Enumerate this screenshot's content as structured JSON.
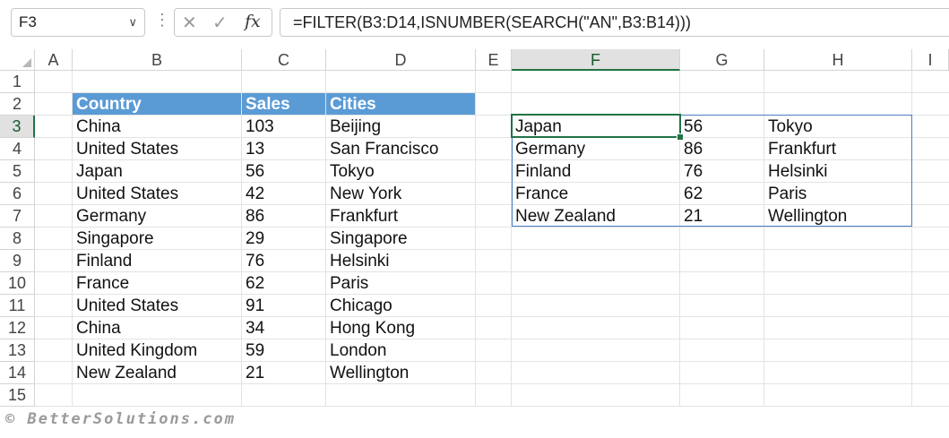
{
  "name_box": {
    "value": "F3",
    "chevron": "chevron-down-icon"
  },
  "formula_bar": {
    "more_icon": "⋮",
    "cancel_icon": "✕",
    "enter_icon": "✓",
    "fx_label": "fx",
    "formula": "=FILTER(B3:D14,ISNUMBER(SEARCH(\"AN\",B3:B14)))"
  },
  "columns": [
    "A",
    "B",
    "C",
    "D",
    "E",
    "F",
    "G",
    "H",
    "I"
  ],
  "selected_column": "F",
  "rows": [
    "1",
    "2",
    "3",
    "4",
    "5",
    "6",
    "7",
    "8",
    "9",
    "10",
    "11",
    "12",
    "13",
    "14",
    "15"
  ],
  "selected_row": "3",
  "source_table": {
    "headers": [
      "Country",
      "Sales",
      "Cities"
    ],
    "rows": [
      [
        "China",
        "103",
        "Beijing"
      ],
      [
        "United States",
        "13",
        "San Francisco"
      ],
      [
        "Japan",
        "56",
        "Tokyo"
      ],
      [
        "United States",
        "42",
        "New York"
      ],
      [
        "Germany",
        "86",
        "Frankfurt"
      ],
      [
        "Singapore",
        "29",
        "Singapore"
      ],
      [
        "Finland",
        "76",
        "Helsinki"
      ],
      [
        "France",
        "62",
        "Paris"
      ],
      [
        "United States",
        "91",
        "Chicago"
      ],
      [
        "China",
        "34",
        "Hong Kong"
      ],
      [
        "United Kingdom",
        "59",
        "London"
      ],
      [
        "New Zealand",
        "21",
        "Wellington"
      ]
    ]
  },
  "result_table": {
    "rows": [
      [
        "Japan",
        "56",
        "Tokyo"
      ],
      [
        "Germany",
        "86",
        "Frankfurt"
      ],
      [
        "Finland",
        "76",
        "Helsinki"
      ],
      [
        "France",
        "62",
        "Paris"
      ],
      [
        "New Zealand",
        "21",
        "Wellington"
      ]
    ]
  },
  "colors": {
    "header_fill": "#5b9bd5",
    "selection": "#217346",
    "spill_border": "#4a7fc1"
  },
  "footer": "© BetterSolutions.com"
}
